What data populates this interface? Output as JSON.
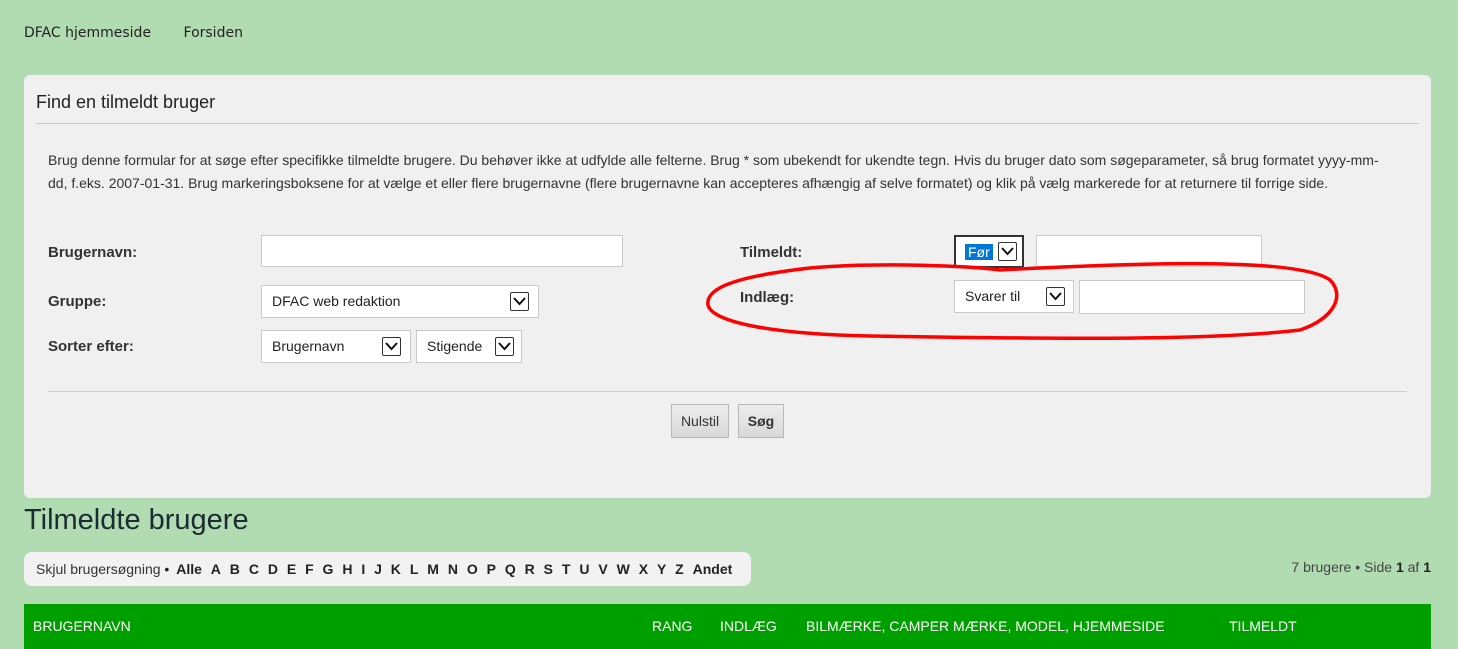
{
  "breadcrumbs": [
    "DFAC hjemmeside",
    "Forsiden"
  ],
  "search_panel": {
    "title": "Find en tilmeldt bruger",
    "description": "Brug denne formular for at søge efter specifikke tilmeldte brugere. Du behøver ikke at udfylde alle felterne. Brug * som ubekendt for ukendte tegn. Hvis du bruger dato som søgeparameter, så brug formatet yyyy-mm-dd, f.eks. 2007-01-31. Brug markeringsboksene for at vælge et eller flere brugernavne (flere brugernavne kan accepteres afhængig af selve formatet) og klik på vælg markerede for at returnere til forrige side.",
    "fields": {
      "username_label": "Brugernavn:",
      "username_value": "",
      "group_label": "Gruppe:",
      "group_selected": "DFAC web redaktion",
      "sort_label": "Sorter efter:",
      "sort_field_selected": "Brugernavn",
      "sort_direction_selected": "Stigende",
      "joined_label": "Tilmeldt:",
      "joined_operator_selected": "Før",
      "joined_value": "",
      "posts_label": "Indlæg:",
      "posts_operator_selected": "Svarer til",
      "posts_value": ""
    },
    "reset_button": "Nulstil",
    "search_button": "Søg"
  },
  "annotation": {
    "color": "#ff0000",
    "shape": "hand-drawn ellipse around posts filter"
  },
  "members": {
    "title": "Tilmeldte brugere",
    "hide_search": "Skjul brugersøgning",
    "separator": "•",
    "letters": [
      "Alle",
      "A",
      "B",
      "C",
      "D",
      "E",
      "F",
      "G",
      "H",
      "I",
      "J",
      "K",
      "L",
      "M",
      "N",
      "O",
      "P",
      "Q",
      "R",
      "S",
      "T",
      "U",
      "V",
      "W",
      "X",
      "Y",
      "Z",
      "Andet"
    ],
    "pagination": {
      "count_text": "7 brugere",
      "separator": "•",
      "page_word": "Side",
      "current_page": "1",
      "of_word": "af",
      "total_pages": "1"
    },
    "columns": [
      "BRUGERNAVN",
      "RANG",
      "INDLÆG",
      "BILMÆRKE, CAMPER MÆRKE, MODEL, HJEMMESIDE",
      "TILMELDT"
    ]
  },
  "colors": {
    "page_background": "#b1dcb1",
    "panel_background": "#f0f0f0",
    "table_header": "#009f00",
    "selection_highlight": "#0078d7"
  }
}
